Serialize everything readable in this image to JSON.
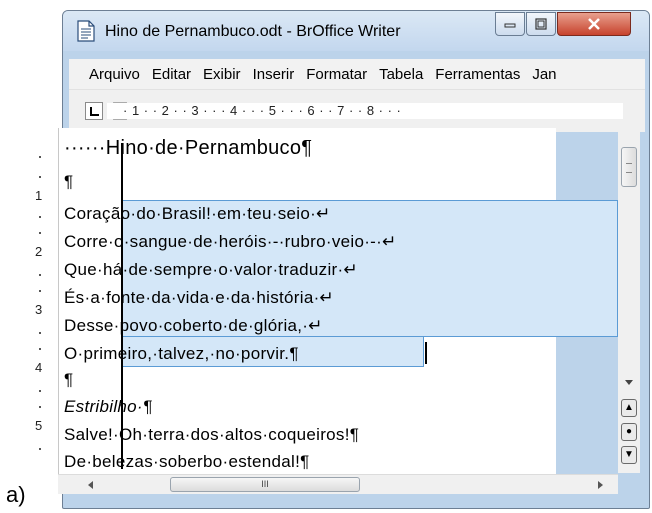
{
  "figure_label": "a)",
  "window": {
    "title": "Hino de Pernambuco.odt - BrOffice Writer",
    "controls": {
      "minimize": "▭",
      "maximize": "▢",
      "close": "✕"
    }
  },
  "menu": {
    "items": [
      {
        "label": "Arquivo"
      },
      {
        "label": "Editar"
      },
      {
        "label": "Exibir"
      },
      {
        "label": "Inserir"
      },
      {
        "label": "Formatar"
      },
      {
        "label": "Tabela"
      },
      {
        "label": "Ferramentas"
      },
      {
        "label": "Jan"
      }
    ]
  },
  "ruler": {
    "horizontal": "· 1 · · 2 · · 3 · · · 4 · · · 5 · · · 6 · · 7 · · 8 · · ·",
    "vertical_numbers": [
      "1",
      "2",
      "3",
      "4",
      "5"
    ]
  },
  "document": {
    "title_line": "······Hino·de·Pernambuco¶",
    "lines": [
      "¶",
      "Coração·do·Brasil!·em·teu·seio·↵",
      "Corre·o·sangue·de·heróis·-·rubro·veio·-·↵",
      "Que·há·de·sempre·o·valor·traduzir·↵",
      "És·a·fonte·da·vida·e·da·história·↵",
      "Desse·povo·coberto·de·glória,·↵",
      "O·primeiro,·talvez,·no·porvir.¶",
      "¶",
      "Estribilho·¶",
      "Salve!·Oh·terra·dos·altos·coqueiros!¶",
      "De·belezas·soberbo·estendal!¶"
    ]
  },
  "scrollbar": {
    "nav_prev": "▲",
    "nav_mid": "●",
    "nav_next": "▼",
    "h_thumb_grip": "III"
  }
}
